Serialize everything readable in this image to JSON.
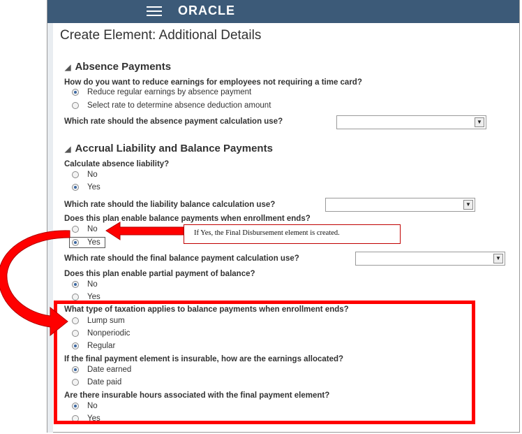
{
  "header": {
    "logo_text": "ORACLE",
    "menu_icon": "hamburger-icon",
    "bar_color": "#3c5a78"
  },
  "page": {
    "title": "Create Element: Additional Details"
  },
  "absence": {
    "heading": "Absence Payments",
    "q1": "How do you want to reduce earnings for employees not requiring a time card?",
    "opt_reduce": "Reduce regular earnings by absence payment",
    "opt_select": "Select rate to determine absence deduction amount",
    "rate_q": "Which rate should the absence payment calculation use?"
  },
  "accrual": {
    "heading": "Accrual Liability and Balance Payments",
    "liab_q": "Calculate absence liability?",
    "liab_no": "No",
    "liab_yes": "Yes",
    "liab_rate_q": "Which rate should the liability balance calculation use?",
    "enroll_q": "Does this plan enable balance payments when enrollment ends?",
    "enroll_no": "No",
    "enroll_yes": "Yes",
    "final_rate_q": "Which rate should the final balance payment calculation use?",
    "partial_q": "Does this plan enable partial payment of balance?",
    "partial_no": "No",
    "partial_yes": "Yes",
    "tax_q": "What type of taxation applies to balance payments when enrollment ends?",
    "tax_lump": "Lump sum",
    "tax_nonperiodic": "Nonperiodic",
    "tax_regular": "Regular",
    "insurable_q": "If the final payment element is insurable, how are the earnings allocated?",
    "ins_earned": "Date earned",
    "ins_paid": "Date paid",
    "hours_q": "Are there insurable hours associated with the final payment element?",
    "hours_no": "No",
    "hours_yes": "Yes"
  },
  "annotation": {
    "callout_text": "If Yes, the Final Disbursement element is created.",
    "highlight_color": "#ff0000",
    "arrow_color": "#ff0000"
  }
}
